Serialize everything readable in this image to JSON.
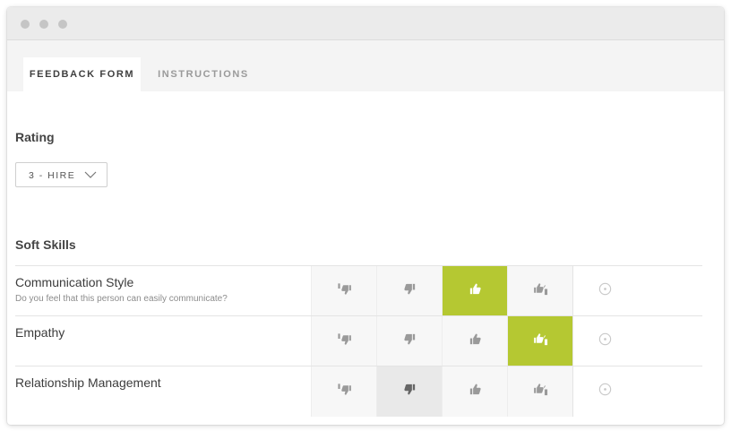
{
  "tabs": [
    {
      "label": "FEEDBACK FORM",
      "active": true
    },
    {
      "label": "INSTRUCTIONS",
      "active": false
    }
  ],
  "rating": {
    "title": "Rating",
    "selected": "3 - HIRE"
  },
  "soft_skills": {
    "title": "Soft Skills",
    "scale_icons": [
      "thumbs-down-double-icon",
      "thumbs-down-icon",
      "thumbs-up-icon",
      "thumbs-up-double-icon",
      "no-opinion-icon"
    ],
    "rows": [
      {
        "label": "Communication Style",
        "description": "Do you feel that this person can easily communicate?",
        "selected_index": 2
      },
      {
        "label": "Empathy",
        "description": "",
        "selected_index": 3
      },
      {
        "label": "Relationship Management",
        "description": "",
        "selected_index": 1
      }
    ]
  },
  "colors": {
    "accent": "#b5c832",
    "negative_selected": "#e9e9e9",
    "icon": "#9a9a9a",
    "icon_negative_selected": "#666666",
    "icon_selected": "#ffffff"
  }
}
